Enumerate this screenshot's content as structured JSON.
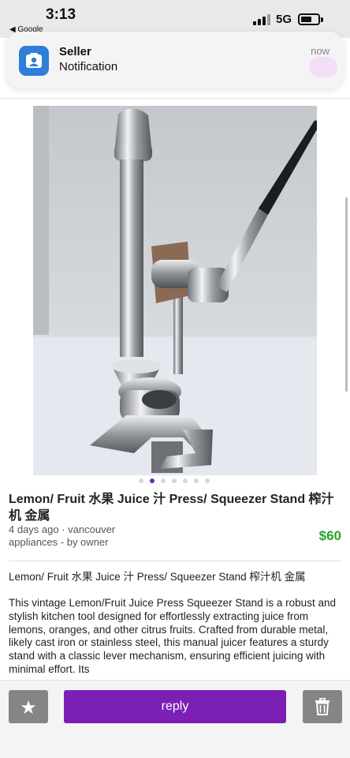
{
  "status_bar": {
    "time": "3:13",
    "back_app": "◀ Google",
    "network": "5G"
  },
  "notification": {
    "title": "Seller",
    "body": "Notification",
    "time": "now",
    "icon": "app-icon"
  },
  "listing": {
    "image_count": 7,
    "active_image": 2,
    "title": "Lemon/ Fruit 水果 Juice 汁 Press/ Squeezer Stand 榨汁机 金属",
    "posted": "4 days ago · vancouver",
    "category": "appliances - by owner",
    "price": "$60",
    "description_title": "Lemon/ Fruit 水果 Juice 汁 Press/ Squeezer Stand 榨汁机 金属",
    "description": "This vintage Lemon/Fruit Juice Press Squeezer Stand is a robust and stylish kitchen tool designed for effortlessly extracting juice from lemons, oranges, and other citrus fruits. Crafted from durable metal, likely cast iron or stainless steel, this manual juicer features a sturdy stand with a classic lever mechanism, ensuring efficient juicing with minimal effort. Its"
  },
  "toolbar": {
    "star_icon": "star-icon",
    "reply_label": "reply",
    "trash_icon": "trash-icon"
  },
  "colors": {
    "reply": "#7b1fb5",
    "price": "#2aa12a",
    "active_dot": "#6a2fb3",
    "gray_button": "#858585"
  }
}
